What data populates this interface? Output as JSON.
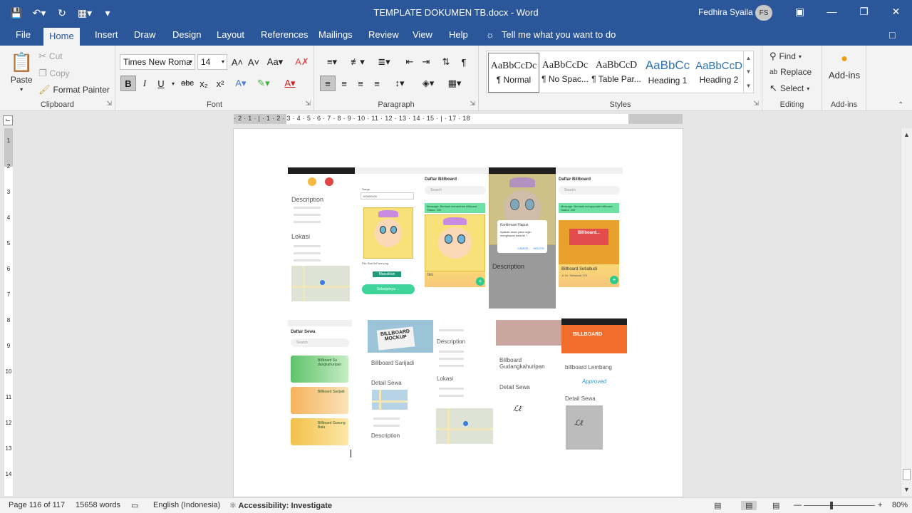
{
  "window": {
    "doc_title": "TEMPLATE DOKUMEN TB.docx  -  Word",
    "user_name": "Fedhira Syaila",
    "user_initials": "FS"
  },
  "tabs": [
    "File",
    "Home",
    "Insert",
    "Draw",
    "Design",
    "Layout",
    "References",
    "Mailings",
    "Review",
    "View",
    "Help"
  ],
  "tell_me": "Tell me what you want to do",
  "clipboard": {
    "paste": "Paste",
    "cut": "Cut",
    "copy": "Copy",
    "format_painter": "Format Painter",
    "label": "Clipboard"
  },
  "font": {
    "name": "Times New Roma",
    "size": "14",
    "label": "Font"
  },
  "paragraph": {
    "label": "Paragraph"
  },
  "styles": {
    "items": [
      {
        "sample": "AaBbCcDc",
        "name": "¶ Normal"
      },
      {
        "sample": "AaBbCcDc",
        "name": "¶ No Spac..."
      },
      {
        "sample": "AaBbCcD",
        "name": "¶ Table Par..."
      },
      {
        "sample": "AaBbCc",
        "name": "Heading 1"
      },
      {
        "sample": "AaBbCcD",
        "name": "Heading 2"
      }
    ],
    "label": "Styles"
  },
  "editing": {
    "find": "Find",
    "replace": "Replace",
    "select": "Select",
    "label": "Editing"
  },
  "addins": {
    "button": "Add-ins",
    "label": "Add-ins"
  },
  "ruler_numbers": "· 2 · 1 · | · 1 · 2 · 3 · 4 · 5 · 6 · 7 · 8 · 9 · 10 · 11 · 12 · 13 · 14 · 15 · | · 17 · 18",
  "vruler_numbers": [
    "1",
    "2",
    "3",
    "4",
    "5",
    "6",
    "7",
    "8",
    "9",
    "10",
    "11",
    "12",
    "13",
    "14"
  ],
  "screens": {
    "s1": {
      "description": "Description",
      "lokasi": "Lokasi"
    },
    "s2": {
      "field_label": "Harga",
      "field_value": "100000000",
      "caption": "File StarOnFace.png",
      "btn1": "Masukkan Gambar",
      "btn2": "Selanjutnya →"
    },
    "s3": {
      "header": "Daftar Billboard",
      "search": "Search",
      "msg": "Message: Berhasil menambah billboard",
      "status": "Status: 200",
      "name": "tes"
    },
    "s4": {
      "dialog_title": "Konfirmasi Hapus",
      "dialog_text": "Apakah anda yakin ingin menghapus data ini ?",
      "cancel": "CANCEL",
      "delete": "DELETE",
      "description": "Description"
    },
    "s5": {
      "header": "Daftar Billboard",
      "search": "Search",
      "msg": "Message: Berhasil mengupdate billboard",
      "status": "Status: 200",
      "billboard": "Billboard...",
      "name": "Billboard Setiabudi",
      "addr": "Jl. Dr. Setiabudi 276"
    },
    "s6": {
      "header": "Daftar Sewa",
      "search": "Search",
      "card1": "Billboard Su dangkahuripan",
      "card2": "Billboard Sarijadi",
      "card3": "Billboard Gunung Batu"
    },
    "s7": {
      "mockup": "BILLBOARD MOCKUP",
      "name": "Billboard Sarijadi",
      "detail": "Detail Sewa",
      "description": "Description"
    },
    "s8": {
      "description": "Description",
      "lokasi": "Lokasi"
    },
    "s9": {
      "name": "Billboard Gudangkahuripan",
      "detail": "Detail Sewa"
    },
    "s10": {
      "orange": "BILLBOARD",
      "name": "billboard Lembang",
      "approved": "Approved",
      "detail": "Detail Sewa"
    }
  },
  "status": {
    "page": "Page 116 of 117",
    "words": "15658 words",
    "language": "English (Indonesia)",
    "accessibility": "Accessibility: Investigate",
    "zoom": "80%"
  }
}
